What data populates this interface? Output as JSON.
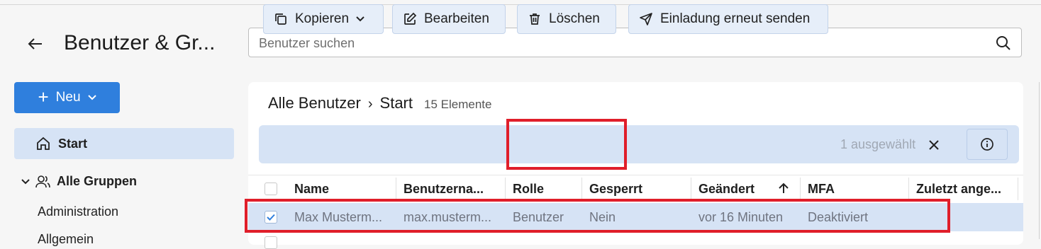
{
  "header": {
    "title": "Benutzer & Gr...",
    "search_placeholder": "Benutzer suchen"
  },
  "sidebar": {
    "new_label": "Neu",
    "start_label": "Start",
    "groups_label": "Alle Gruppen",
    "group_items": [
      "Administration",
      "Allgemein"
    ]
  },
  "main": {
    "breadcrumb": [
      "Alle Benutzer",
      "Start"
    ],
    "breadcrumb_separator": "›",
    "item_count": "15 Elemente",
    "toolbar": {
      "copy": "Kopieren",
      "edit": "Bearbeiten",
      "delete": "Löschen",
      "resend_invite": "Einladung erneut senden",
      "selected_count": "1 ausgewählt"
    },
    "table": {
      "columns": [
        "Name",
        "Benutzerna...",
        "Rolle",
        "Gesperrt",
        "Geändert",
        "MFA",
        "Zuletzt ange..."
      ],
      "sorted_column": "Geändert",
      "sort_direction": "ascending",
      "rows": [
        {
          "selected": true,
          "cells": [
            "Max Musterm...",
            "max.musterm...",
            "Benutzer",
            "Nein",
            "vor 16 Minuten",
            "Deaktiviert",
            ""
          ]
        }
      ]
    }
  },
  "colors": {
    "accent": "#2f7fdd",
    "selection": "#d6e3f5",
    "highlight_box": "#e01e2a"
  },
  "icons": [
    "back-arrow-icon",
    "search-icon",
    "plus-icon",
    "chevron-down-icon",
    "home-icon",
    "users-icon",
    "copy-icon",
    "edit-icon",
    "trash-icon",
    "send-icon",
    "close-icon",
    "info-icon",
    "sort-arrow-up-icon",
    "check-icon"
  ]
}
